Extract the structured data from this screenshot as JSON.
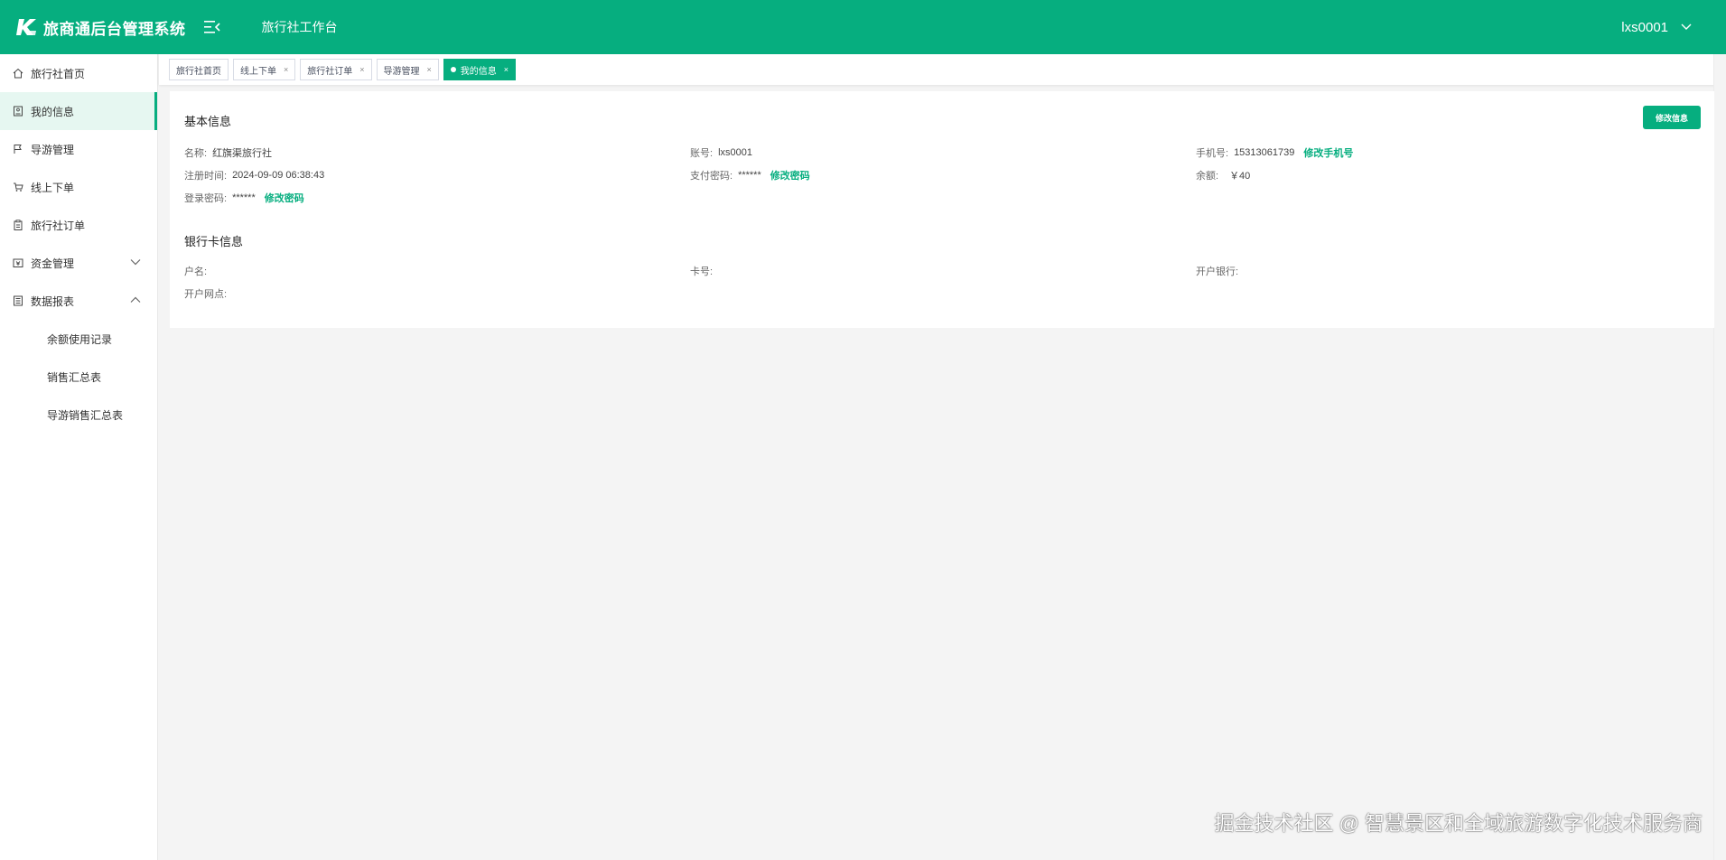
{
  "header": {
    "app_title": "旅商通后台管理系统",
    "workspace_title": "旅行社工作台",
    "username": "lxs0001",
    "accent_color": "#06ae7f"
  },
  "sidebar": {
    "items": [
      {
        "label": "旅行社首页",
        "icon": "home-icon"
      },
      {
        "label": "我的信息",
        "icon": "profile-icon",
        "active": true
      },
      {
        "label": "导游管理",
        "icon": "flag-icon"
      },
      {
        "label": "线上下单",
        "icon": "cart-icon"
      },
      {
        "label": "旅行社订单",
        "icon": "clipboard-icon"
      },
      {
        "label": "资金管理",
        "icon": "wallet-icon",
        "expandable": true,
        "expanded": false
      },
      {
        "label": "数据报表",
        "icon": "report-icon",
        "expandable": true,
        "expanded": true
      }
    ],
    "sub_items": [
      "余额使用记录",
      "销售汇总表",
      "导游销售汇总表"
    ]
  },
  "tabs": [
    {
      "label": "旅行社首页",
      "closable": false
    },
    {
      "label": "线上下单",
      "closable": true
    },
    {
      "label": "旅行社订单",
      "closable": true
    },
    {
      "label": "导游管理",
      "closable": true
    },
    {
      "label": "我的信息",
      "closable": true,
      "active": true
    }
  ],
  "tab_close_glyph": "×",
  "basic_info": {
    "title": "基本信息",
    "edit_button": "修改信息",
    "name_label": "名称:",
    "name_value": "红旗渠旅行社",
    "account_label": "账号:",
    "account_value": "lxs0001",
    "phone_label": "手机号:",
    "phone_value": "15313061739",
    "phone_link": "修改手机号",
    "register_label": "注册时间:",
    "register_value": "2024-09-09 06:38:43",
    "pay_pwd_label": "支付密码:",
    "pay_pwd_value": "******",
    "pay_pwd_link": "修改密码",
    "balance_label": "余额:",
    "balance_value": "￥40",
    "login_pwd_label": "登录密码:",
    "login_pwd_value": "******",
    "login_pwd_link": "修改密码"
  },
  "bank_info": {
    "title": "银行卡信息",
    "holder_label": "户名:",
    "card_label": "卡号:",
    "bank_label": "开户银行:",
    "branch_label": "开户网点:"
  },
  "watermark": "掘金技术社区 @ 智慧景区和全域旅游数字化技术服务商"
}
